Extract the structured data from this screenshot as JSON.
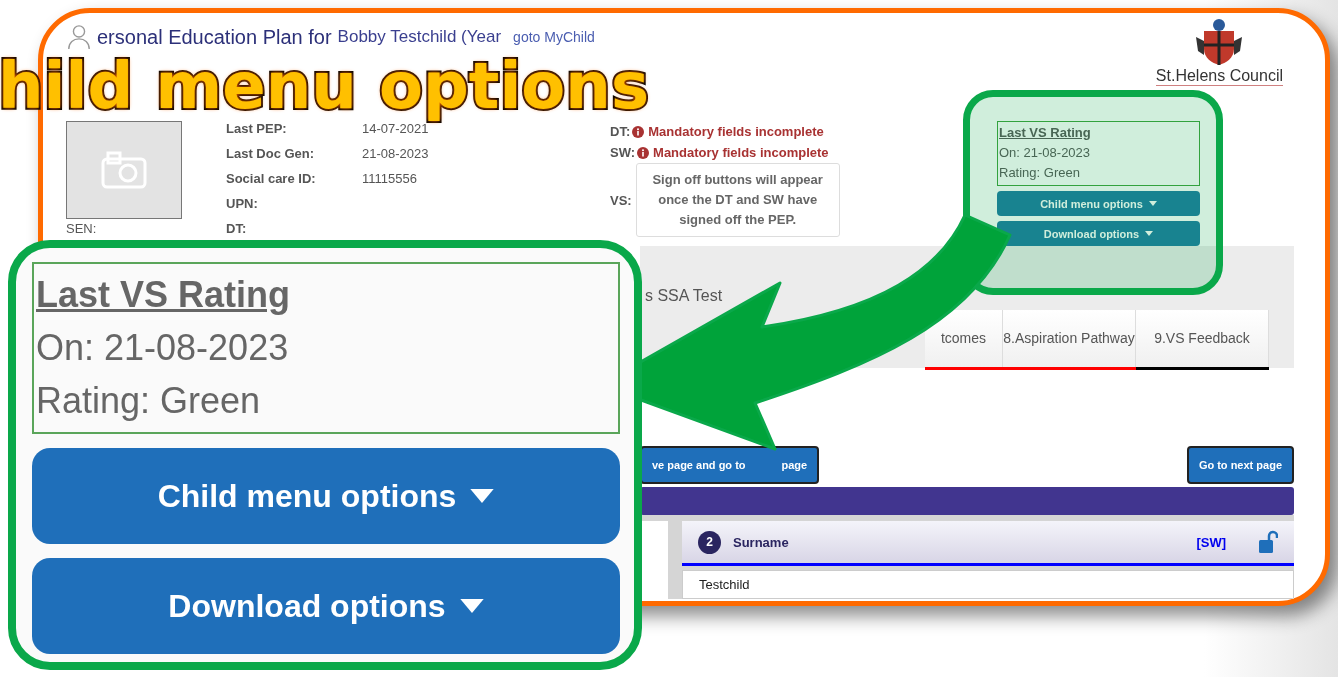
{
  "banner_title": "hild menu options",
  "header": {
    "title": "ersonal Education Plan for",
    "child_name": "Bobby Testchild (Year",
    "link": "goto MyChild",
    "council": "St.Helens Council"
  },
  "photo": {
    "label": "SEN:"
  },
  "details": [
    {
      "label": "Last PEP:",
      "value": "14-07-2021"
    },
    {
      "label": "Last Doc Gen:",
      "value": "21-08-2023"
    },
    {
      "label": "Social care ID:",
      "value": "11115556"
    },
    {
      "label": "UPN:"
    },
    {
      "label": "DT:"
    }
  ],
  "signoff": {
    "statuses": [
      {
        "label": "DT:",
        "text": "Mandatory fields incomplete"
      },
      {
        "label": "SW:",
        "text": "Mandatory fields incomplete"
      }
    ],
    "vs_label": "VS:",
    "note": "Sign off buttons will appear once the DT and SW have signed off the PEP."
  },
  "rating_panel": {
    "title": "Last VS Rating",
    "date": "On: 21-08-2023",
    "rating": "Rating: Green",
    "buttons": [
      "Child menu options",
      "Download options"
    ]
  },
  "section_title": "s SSA Test",
  "tabs": [
    {
      "label": "tcomes",
      "color": "#ff0000"
    },
    {
      "label": "8.Aspiration Pathway",
      "color": "#ff0000"
    },
    {
      "label": "9.VS Feedback",
      "color": "#000000"
    }
  ],
  "nav_buttons": {
    "back": [
      "ve page and go to",
      "page"
    ],
    "next": "Go to next page"
  },
  "field": {
    "number": "2",
    "label": "Surname",
    "role": "[SW]",
    "value": "Testchild"
  },
  "callout": {
    "title": "Last VS Rating",
    "date": "On: 21-08-2023",
    "rating": "Rating: Green",
    "buttons": [
      "Child menu options",
      "Download options"
    ]
  }
}
